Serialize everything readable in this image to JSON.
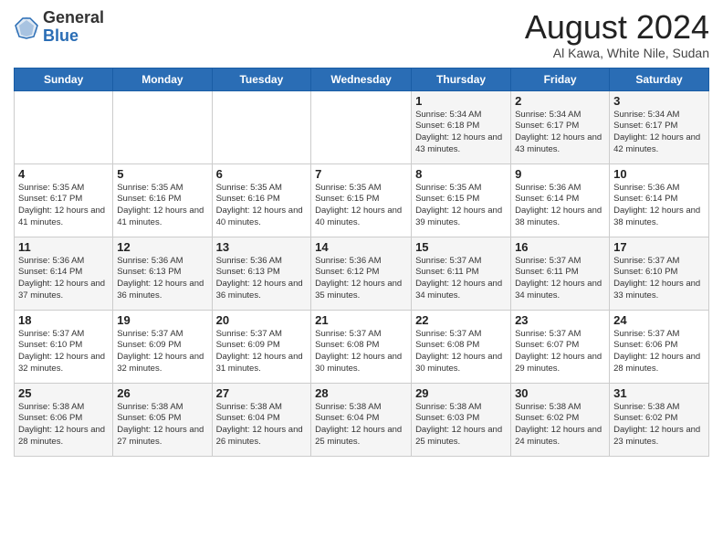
{
  "header": {
    "logo_general": "General",
    "logo_blue": "Blue",
    "month_year": "August 2024",
    "location": "Al Kawa, White Nile, Sudan"
  },
  "weekdays": [
    "Sunday",
    "Monday",
    "Tuesday",
    "Wednesday",
    "Thursday",
    "Friday",
    "Saturday"
  ],
  "weeks": [
    [
      {
        "day": "",
        "detail": ""
      },
      {
        "day": "",
        "detail": ""
      },
      {
        "day": "",
        "detail": ""
      },
      {
        "day": "",
        "detail": ""
      },
      {
        "day": "1",
        "detail": "Sunrise: 5:34 AM\nSunset: 6:18 PM\nDaylight: 12 hours\nand 43 minutes."
      },
      {
        "day": "2",
        "detail": "Sunrise: 5:34 AM\nSunset: 6:17 PM\nDaylight: 12 hours\nand 43 minutes."
      },
      {
        "day": "3",
        "detail": "Sunrise: 5:34 AM\nSunset: 6:17 PM\nDaylight: 12 hours\nand 42 minutes."
      }
    ],
    [
      {
        "day": "4",
        "detail": "Sunrise: 5:35 AM\nSunset: 6:17 PM\nDaylight: 12 hours\nand 41 minutes."
      },
      {
        "day": "5",
        "detail": "Sunrise: 5:35 AM\nSunset: 6:16 PM\nDaylight: 12 hours\nand 41 minutes."
      },
      {
        "day": "6",
        "detail": "Sunrise: 5:35 AM\nSunset: 6:16 PM\nDaylight: 12 hours\nand 40 minutes."
      },
      {
        "day": "7",
        "detail": "Sunrise: 5:35 AM\nSunset: 6:15 PM\nDaylight: 12 hours\nand 40 minutes."
      },
      {
        "day": "8",
        "detail": "Sunrise: 5:35 AM\nSunset: 6:15 PM\nDaylight: 12 hours\nand 39 minutes."
      },
      {
        "day": "9",
        "detail": "Sunrise: 5:36 AM\nSunset: 6:14 PM\nDaylight: 12 hours\nand 38 minutes."
      },
      {
        "day": "10",
        "detail": "Sunrise: 5:36 AM\nSunset: 6:14 PM\nDaylight: 12 hours\nand 38 minutes."
      }
    ],
    [
      {
        "day": "11",
        "detail": "Sunrise: 5:36 AM\nSunset: 6:14 PM\nDaylight: 12 hours\nand 37 minutes."
      },
      {
        "day": "12",
        "detail": "Sunrise: 5:36 AM\nSunset: 6:13 PM\nDaylight: 12 hours\nand 36 minutes."
      },
      {
        "day": "13",
        "detail": "Sunrise: 5:36 AM\nSunset: 6:13 PM\nDaylight: 12 hours\nand 36 minutes."
      },
      {
        "day": "14",
        "detail": "Sunrise: 5:36 AM\nSunset: 6:12 PM\nDaylight: 12 hours\nand 35 minutes."
      },
      {
        "day": "15",
        "detail": "Sunrise: 5:37 AM\nSunset: 6:11 PM\nDaylight: 12 hours\nand 34 minutes."
      },
      {
        "day": "16",
        "detail": "Sunrise: 5:37 AM\nSunset: 6:11 PM\nDaylight: 12 hours\nand 34 minutes."
      },
      {
        "day": "17",
        "detail": "Sunrise: 5:37 AM\nSunset: 6:10 PM\nDaylight: 12 hours\nand 33 minutes."
      }
    ],
    [
      {
        "day": "18",
        "detail": "Sunrise: 5:37 AM\nSunset: 6:10 PM\nDaylight: 12 hours\nand 32 minutes."
      },
      {
        "day": "19",
        "detail": "Sunrise: 5:37 AM\nSunset: 6:09 PM\nDaylight: 12 hours\nand 32 minutes."
      },
      {
        "day": "20",
        "detail": "Sunrise: 5:37 AM\nSunset: 6:09 PM\nDaylight: 12 hours\nand 31 minutes."
      },
      {
        "day": "21",
        "detail": "Sunrise: 5:37 AM\nSunset: 6:08 PM\nDaylight: 12 hours\nand 30 minutes."
      },
      {
        "day": "22",
        "detail": "Sunrise: 5:37 AM\nSunset: 6:08 PM\nDaylight: 12 hours\nand 30 minutes."
      },
      {
        "day": "23",
        "detail": "Sunrise: 5:37 AM\nSunset: 6:07 PM\nDaylight: 12 hours\nand 29 minutes."
      },
      {
        "day": "24",
        "detail": "Sunrise: 5:37 AM\nSunset: 6:06 PM\nDaylight: 12 hours\nand 28 minutes."
      }
    ],
    [
      {
        "day": "25",
        "detail": "Sunrise: 5:38 AM\nSunset: 6:06 PM\nDaylight: 12 hours\nand 28 minutes."
      },
      {
        "day": "26",
        "detail": "Sunrise: 5:38 AM\nSunset: 6:05 PM\nDaylight: 12 hours\nand 27 minutes."
      },
      {
        "day": "27",
        "detail": "Sunrise: 5:38 AM\nSunset: 6:04 PM\nDaylight: 12 hours\nand 26 minutes."
      },
      {
        "day": "28",
        "detail": "Sunrise: 5:38 AM\nSunset: 6:04 PM\nDaylight: 12 hours\nand 25 minutes."
      },
      {
        "day": "29",
        "detail": "Sunrise: 5:38 AM\nSunset: 6:03 PM\nDaylight: 12 hours\nand 25 minutes."
      },
      {
        "day": "30",
        "detail": "Sunrise: 5:38 AM\nSunset: 6:02 PM\nDaylight: 12 hours\nand 24 minutes."
      },
      {
        "day": "31",
        "detail": "Sunrise: 5:38 AM\nSunset: 6:02 PM\nDaylight: 12 hours\nand 23 minutes."
      }
    ]
  ]
}
